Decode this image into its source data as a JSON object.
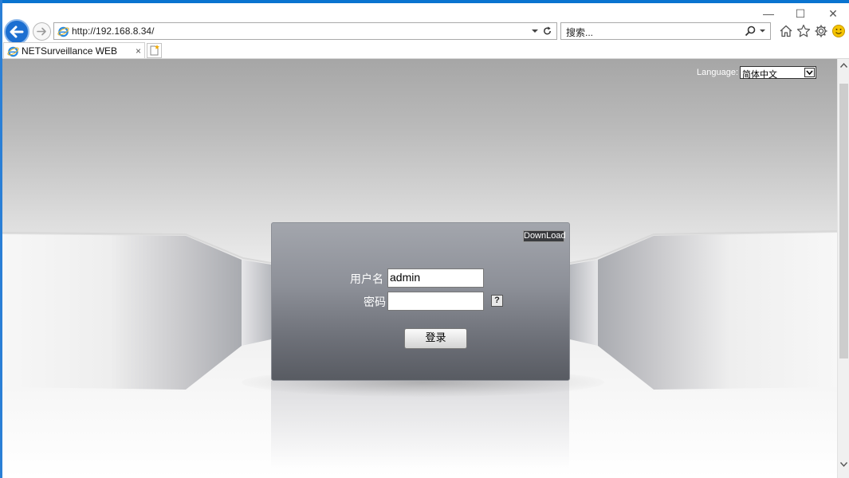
{
  "browser": {
    "address": "http://192.168.8.34/",
    "search_placeholder": "搜索...",
    "tab_title": "NETSurveillance WEB",
    "tab_close": "×",
    "window_controls": {
      "minimize": "—",
      "maximize": "☐",
      "close": "✕"
    }
  },
  "page": {
    "language_label": "Language:",
    "language_value": "简体中文",
    "download_label": "DownLoad",
    "username_label": "用户名",
    "username_value": "admin",
    "password_label": "密码",
    "help_label": "?",
    "login_label": "登录"
  },
  "icons": [
    "back-arrow-icon",
    "forward-arrow-icon",
    "ie-icon",
    "refresh-icon",
    "search-icon",
    "home-icon",
    "favorites-star-icon",
    "settings-gear-icon",
    "smiley-feedback-icon",
    "new-tab-icon"
  ],
  "colors": {
    "accent": "#1c6fd1",
    "panel_top": "#a3a6ad",
    "panel_bottom": "#585b62"
  }
}
